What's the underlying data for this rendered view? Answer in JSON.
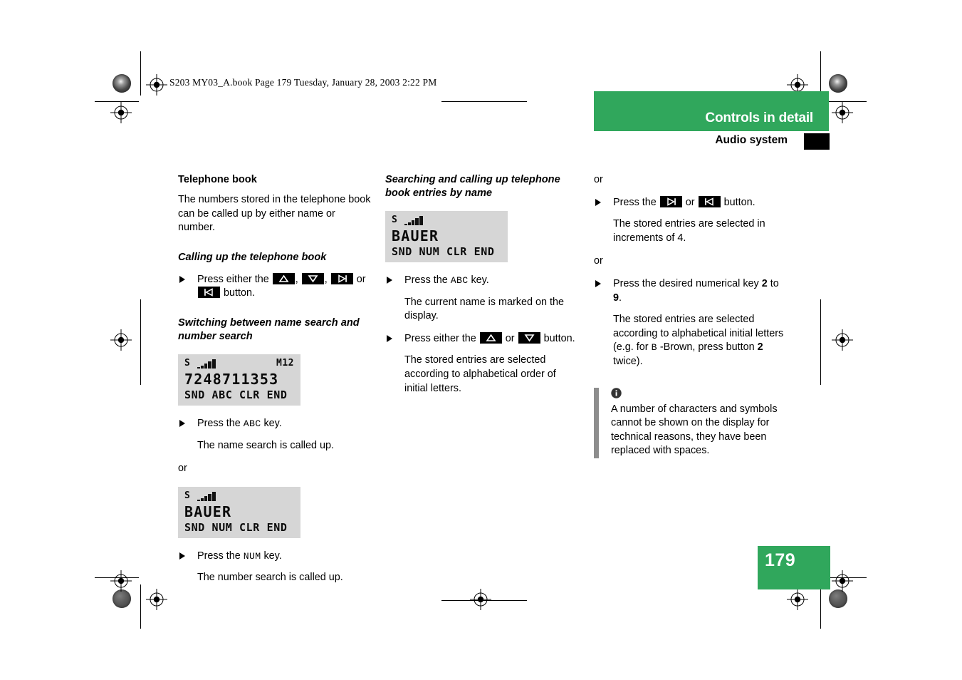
{
  "prepress": {
    "file_info": "S203 MY03_A.book  Page 179  Tuesday, January 28, 2003  2:22 PM"
  },
  "header": {
    "title": "Controls in detail",
    "subtitle": "Audio system",
    "green": "#30a75c",
    "tab_color": "#000000"
  },
  "page_number": "179",
  "col1": {
    "heading": "Telephone book",
    "intro": "The numbers stored in the telephone book can be called up by either name or number.",
    "sub1": "Calling up the telephone book",
    "step1_pre": "Press either the",
    "step1_sep": ",",
    "step1_or": "or",
    "step1_post": "button.",
    "sub2": "Switching between name search and number search",
    "lcd1": {
      "signal_label": "S",
      "memory": "M12",
      "line": "7248711353",
      "softkeys": "SND ABC CLR END"
    },
    "step2_pre": "Press the",
    "step2_key": "ABC",
    "step2_post": "key.",
    "result2": "The name search is called up.",
    "or": "or",
    "lcd2": {
      "signal_label": "S",
      "memory": "",
      "line": "BAUER",
      "softkeys": "SND NUM CLR END"
    },
    "step3_pre": "Press the",
    "step3_key": "NUM",
    "step3_post": "key.",
    "result3": "The number search is called up."
  },
  "col2": {
    "sub1": "Searching and calling up telephone book entries by name",
    "lcd1": {
      "signal_label": "S",
      "memory": "",
      "line": "BAUER",
      "softkeys": "SND NUM CLR END"
    },
    "step1_pre": "Press the",
    "step1_key": "ABC",
    "step1_post": "key.",
    "result1": "The current name is marked on the display.",
    "step2_pre": "Press either the",
    "step2_or": "or",
    "step2_post": "button.",
    "result2": "The stored entries are selected according to alphabetical order of initial letters."
  },
  "col3": {
    "or1": "or",
    "step1_pre": "Press the",
    "step1_or": "or",
    "step1_post": "button.",
    "result1": "The stored entries are selected in increments of 4.",
    "or2": "or",
    "step2_pre": "Press the desired numerical key",
    "step2_num1": "2",
    "step2_mid": "to",
    "step2_num2": "9",
    "step2_post": ".",
    "result2_a": "The stored entries are selected according to alphabetical initial letters (e.g. for",
    "result2_key": "B",
    "result2_b": "-Brown, press button",
    "result2_num": "2",
    "result2_c": "twice).",
    "note": {
      "icon": "info-icon",
      "text": "A number of characters and symbols cannot be shown on the display for technical reasons, they have been replaced with spaces."
    }
  },
  "icons": {
    "up": "triangle-up-key-icon",
    "down": "triangle-down-key-icon",
    "next": "skip-forward-key-icon",
    "prev": "skip-back-key-icon"
  }
}
